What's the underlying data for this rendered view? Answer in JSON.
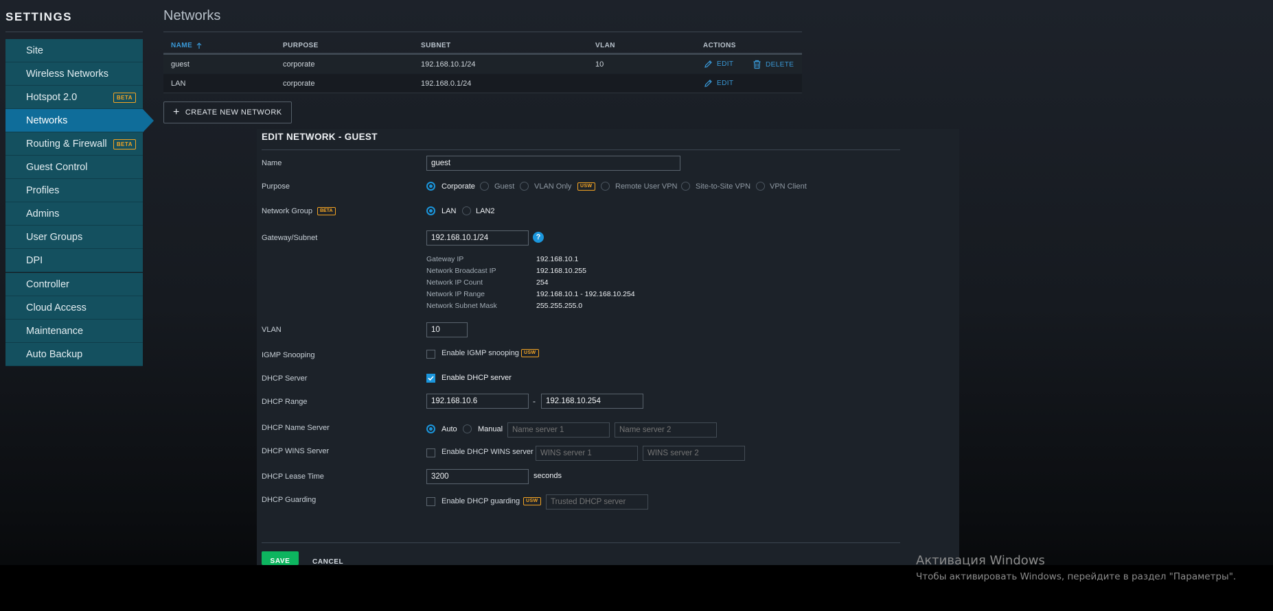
{
  "sidebar": {
    "title": "SETTINGS",
    "group1": [
      {
        "label": "Site"
      },
      {
        "label": "Wireless Networks"
      },
      {
        "label": "Hotspot 2.0",
        "badge": "BETA"
      },
      {
        "label": "Networks",
        "active": true
      },
      {
        "label": "Routing & Firewall",
        "badge": "BETA"
      },
      {
        "label": "Guest Control"
      },
      {
        "label": "Profiles"
      },
      {
        "label": "Admins"
      },
      {
        "label": "User Groups"
      },
      {
        "label": "DPI"
      }
    ],
    "group2": [
      {
        "label": "Controller"
      },
      {
        "label": "Cloud Access"
      },
      {
        "label": "Maintenance"
      },
      {
        "label": "Auto Backup"
      }
    ]
  },
  "networks": {
    "title": "Networks",
    "columns": {
      "name": "NAME",
      "purpose": "PURPOSE",
      "subnet": "SUBNET",
      "vlan": "VLAN",
      "actions": "ACTIONS"
    },
    "sort_icon": "arrow-up-icon",
    "rows": [
      {
        "name": "guest",
        "purpose": "corporate",
        "subnet": "192.168.10.1/24",
        "vlan": "10",
        "edit": "EDIT",
        "delete": "DELETE"
      },
      {
        "name": "LAN",
        "purpose": "corporate",
        "subnet": "192.168.0.1/24",
        "vlan": "",
        "edit": "EDIT"
      }
    ],
    "create_label": "CREATE NEW NETWORK"
  },
  "edit": {
    "title": "EDIT NETWORK - GUEST",
    "name_label": "Name",
    "name_value": "guest",
    "purpose_label": "Purpose",
    "purpose_options": [
      "Corporate",
      "Guest",
      "VLAN Only",
      "Remote User VPN",
      "Site-to-Site VPN",
      "VPN Client"
    ],
    "purpose_selected": "Corporate",
    "usw_badge": "USW",
    "beta_badge": "BETA",
    "group_label": "Network Group",
    "group_options": [
      "LAN",
      "LAN2"
    ],
    "gateway_label": "Gateway/Subnet",
    "gateway_value": "192.168.10.1/24",
    "help_glyph": "?",
    "info": [
      {
        "k": "Gateway IP",
        "v": "192.168.10.1"
      },
      {
        "k": "Network Broadcast IP",
        "v": "192.168.10.255"
      },
      {
        "k": "Network IP Count",
        "v": "254"
      },
      {
        "k": "Network IP Range",
        "v": "192.168.10.1 - 192.168.10.254"
      },
      {
        "k": "Network Subnet Mask",
        "v": "255.255.255.0"
      }
    ],
    "vlan_label": "VLAN",
    "vlan_value": "10",
    "igmp_label": "IGMP Snooping",
    "igmp_check": "Enable IGMP snooping",
    "dhcp_label": "DHCP Server",
    "dhcp_check": "Enable DHCP server",
    "range_label": "DHCP Range",
    "range_start": "192.168.10.6",
    "range_sep": "-",
    "range_end": "192.168.10.254",
    "ns_label": "DHCP Name Server",
    "ns_auto": "Auto",
    "ns_manual": "Manual",
    "ns1_placeholder": "Name server 1",
    "ns2_placeholder": "Name server 2",
    "wins_label": "DHCP WINS Server",
    "wins_check": "Enable DHCP WINS server",
    "wins1_placeholder": "WINS server 1",
    "wins2_placeholder": "WINS server 2",
    "lease_label": "DHCP Lease Time",
    "lease_value": "3200",
    "lease_unit": "seconds",
    "guard_label": "DHCP Guarding",
    "guard_check": "Enable DHCP guarding",
    "guard_placeholder": "Trusted DHCP server",
    "save": "SAVE",
    "cancel": "CANCEL"
  },
  "watermark": {
    "title": "Активация Windows",
    "subtitle": "Чтобы активировать Windows, перейдите в раздел \"Параметры\"."
  },
  "colors": {
    "accent": "#1b96dc",
    "sidebar_bg": "#14505f",
    "sidebar_active": "#0f6d9a",
    "badge": "#f5a524",
    "save": "#0db55f"
  }
}
